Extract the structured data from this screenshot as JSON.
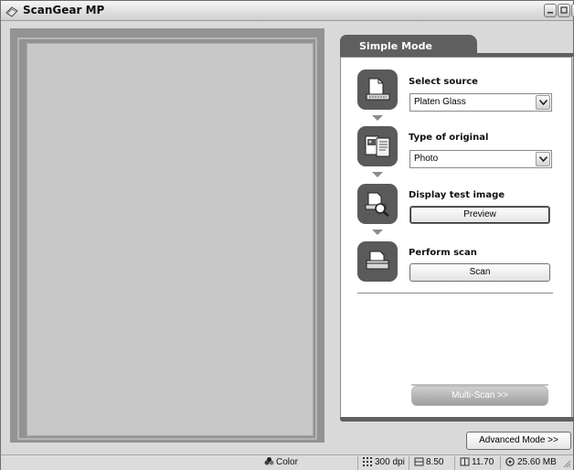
{
  "window": {
    "title": "ScanGear MP"
  },
  "tab": {
    "label": "Simple Mode"
  },
  "steps": [
    {
      "label": "Select source",
      "control": "select",
      "value": "Platen Glass"
    },
    {
      "label": "Type of original",
      "control": "select",
      "value": "Photo"
    },
    {
      "label": "Display test image",
      "control": "button",
      "value": "Preview"
    },
    {
      "label": "Perform scan",
      "control": "button",
      "value": "Scan"
    }
  ],
  "buttons": {
    "multi_scan": "Multi-Scan >>",
    "advanced_mode": "Advanced Mode >>"
  },
  "status": {
    "color_mode": "Color",
    "resolution": "300 dpi",
    "width": "8.50",
    "height": "11.70",
    "file_size": "25.60 MB"
  },
  "colors": {
    "panel_header": "#5f5f5f",
    "preview_bg": "#c8c8c8",
    "window_bg": "#d9d9d9"
  }
}
